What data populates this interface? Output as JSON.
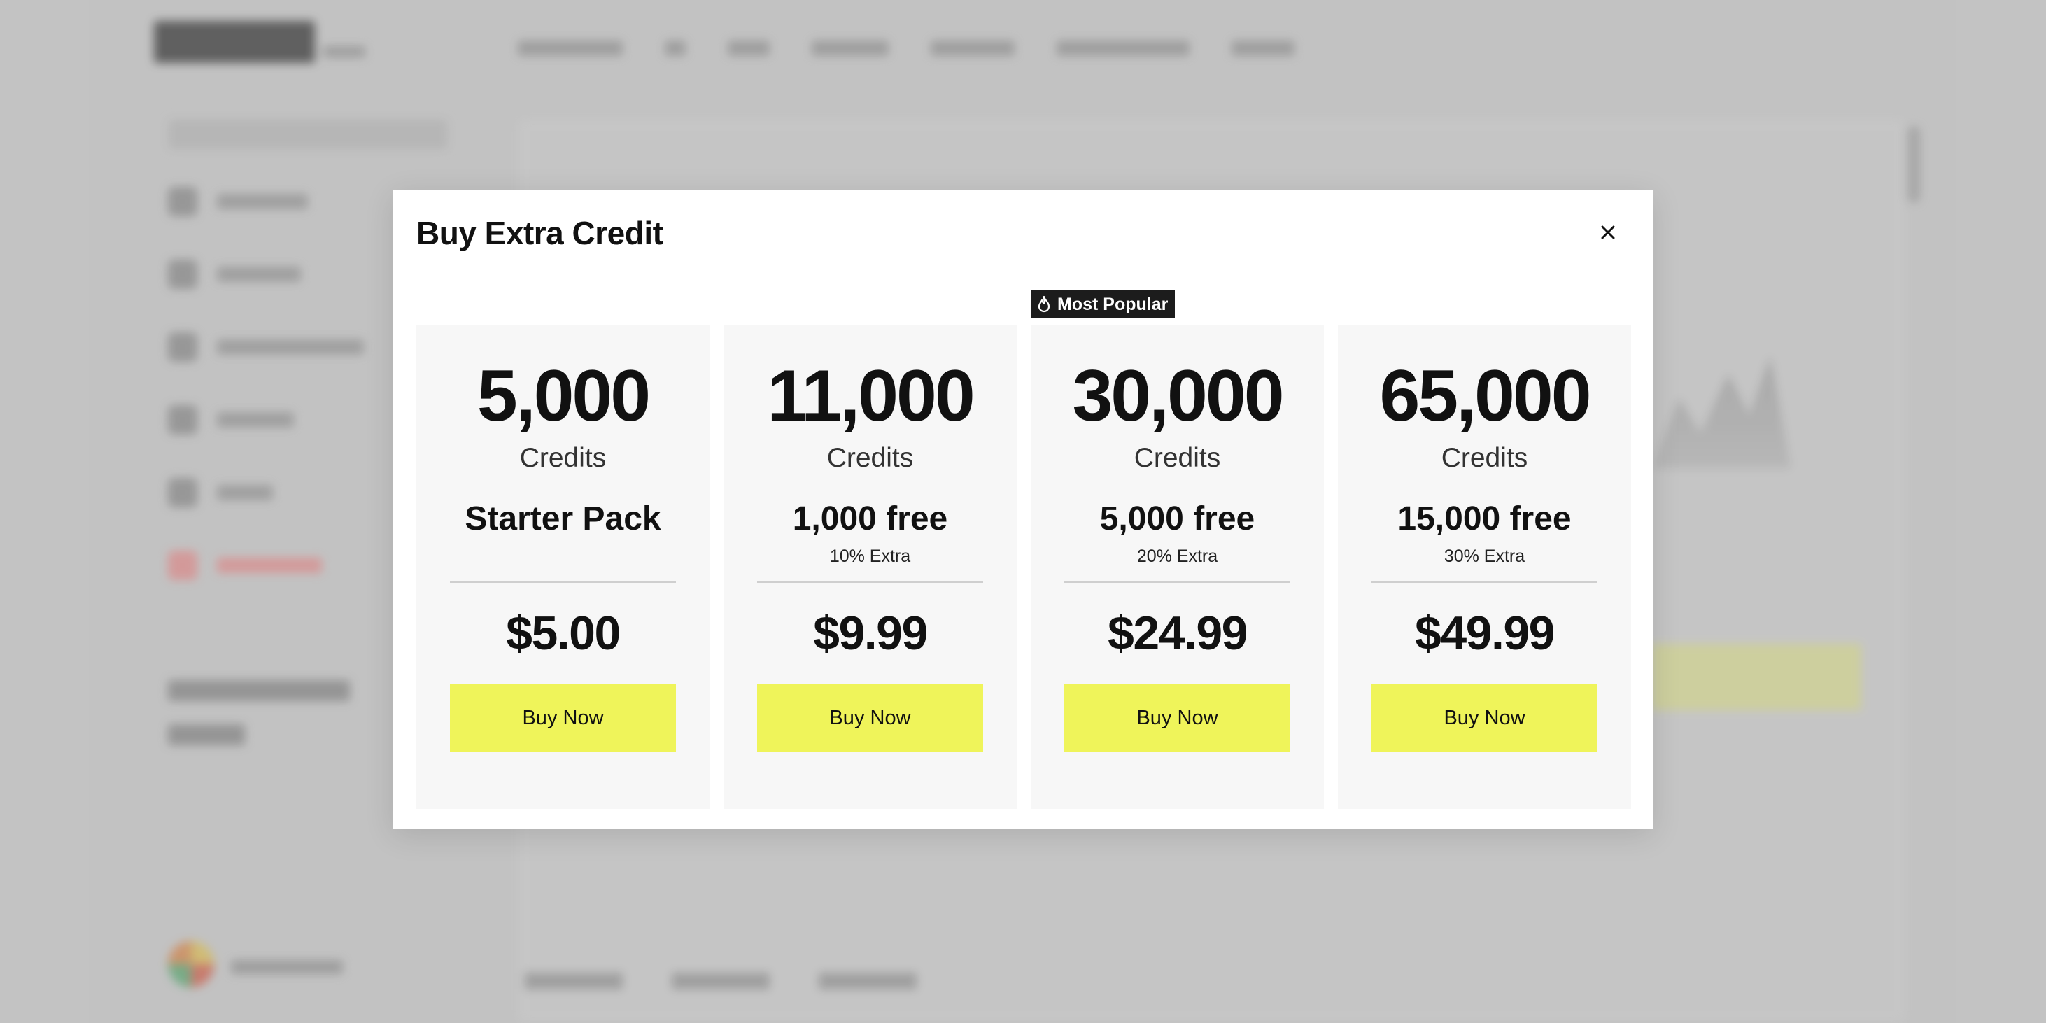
{
  "modal": {
    "title": "Buy Extra Credit",
    "close_icon": "close-icon"
  },
  "packs": [
    {
      "amount": "5,000",
      "unit": "Credits",
      "bonus": "Starter Pack",
      "extra": "",
      "price": "$5.00",
      "button": "Buy Now",
      "badge": ""
    },
    {
      "amount": "11,000",
      "unit": "Credits",
      "bonus": "1,000 free",
      "extra": "10% Extra",
      "price": "$9.99",
      "button": "Buy Now",
      "badge": ""
    },
    {
      "amount": "30,000",
      "unit": "Credits",
      "bonus": "5,000 free",
      "extra": "20% Extra",
      "price": "$24.99",
      "button": "Buy Now",
      "badge": "Most Popular",
      "badge_icon": "flame-icon"
    },
    {
      "amount": "65,000",
      "unit": "Credits",
      "bonus": "15,000 free",
      "extra": "30% Extra",
      "price": "$49.99",
      "button": "Buy Now",
      "badge": ""
    }
  ],
  "colors": {
    "accent": "#eff45a",
    "card_bg": "#f7f7f7",
    "badge_bg": "#1c1c1c"
  }
}
